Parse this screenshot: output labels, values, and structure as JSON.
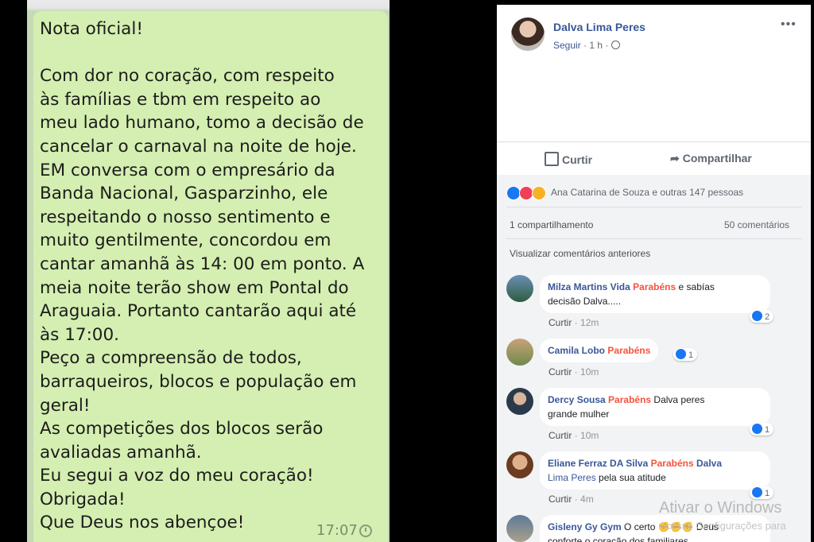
{
  "whatsapp": {
    "message": "Nota oficial!\n\nCom dor no coração, com respeito\nàs famílias e tbm em respeito ao\nmeu lado humano, tomo a decisão de\ncancelar o carnaval na noite de hoje.\nEM conversa com o empresário da\nBanda Nacional, Gasparzinho, ele\nrespeitando o nosso sentimento e\nmuito gentilmente, concordou em\ncantar amanhã às 14: 00 em ponto. A\nmeia noite terão show em Pontal do\nAraguaia. Portanto cantarão aqui até\nàs 17:00.\nPeço a compreensão de todos,\nbarraqueiros, blocos e população em\ngeral!\nAs competições dos blocos serão\navaliadas amanhã.\nEu segui a voz do meu coração!\nObrigada!\nQue Deus nos abençoe!",
    "time": "17:07"
  },
  "post": {
    "author": "Dalva Lima Peres",
    "follow": "Seguir",
    "meta": "· 1 h ·",
    "more": "•••",
    "like_label": "Curtir",
    "share_label": "Compartilhar",
    "reactions_text": "Ana Catarina de Souza e outras 147 pessoas",
    "shares": "1 compartilhamento",
    "comments_count": "50 comentários",
    "view_previous": "Visualizar comentários anteriores"
  },
  "comments": [
    {
      "name": "Milza Martins Vida",
      "highlight": "Parabéns",
      "text": " e sabías",
      "text2": "decisão Dalva.....",
      "like": "Curtir",
      "time": "12m",
      "likes": "2"
    },
    {
      "name": "Camila Lobo",
      "highlight": "Parabéns",
      "text": "",
      "text2": "",
      "like": "Curtir",
      "time": "10m",
      "likes": "1"
    },
    {
      "name": "Dercy Sousa",
      "highlight": "Parabéns",
      "text": " Dalva peres",
      "text2": "grande mulher",
      "like": "Curtir",
      "time": "10m",
      "likes": "1"
    },
    {
      "name": "Eliane Ferraz DA Silva",
      "highlight": "Parabéns",
      "text": " Dalva",
      "text2": "pela sua atitude",
      "text2_link": "Lima Peres",
      "like": "Curtir",
      "time": "4m",
      "likes": "1"
    },
    {
      "name": "Gisleny Gy Gym",
      "highlight": "",
      "text": " O certo",
      "text2": "conforte o coração dos familiares",
      "tail": "Deus"
    }
  ],
  "watermark": {
    "line1": "Ativar o Windows",
    "line2": "Acesse Configurações para"
  },
  "colors": {
    "fb_blue": "#385898",
    "highlight": "#f5533d",
    "bubble": "#d4efb1"
  }
}
